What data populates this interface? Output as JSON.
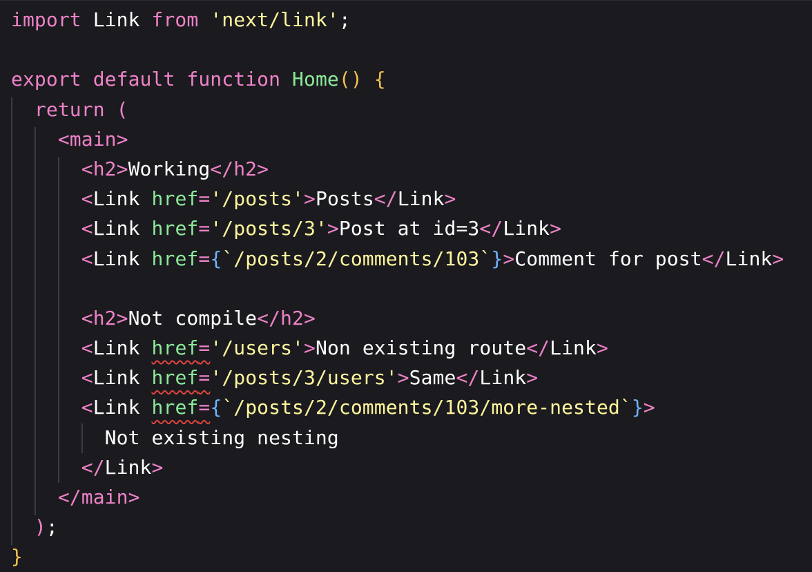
{
  "editor": {
    "lines": [
      {
        "tokens": [
          [
            "k",
            "import"
          ],
          [
            "pl",
            " Link "
          ],
          [
            "k",
            "from"
          ],
          [
            "pl",
            " "
          ],
          [
            "st",
            "'next/link'"
          ],
          [
            "pl",
            ";"
          ]
        ]
      },
      {
        "tokens": []
      },
      {
        "tokens": [
          [
            "k",
            "export"
          ],
          [
            "pl",
            " "
          ],
          [
            "k",
            "default"
          ],
          [
            "pl",
            " "
          ],
          [
            "k",
            "function"
          ],
          [
            "pl",
            " "
          ],
          [
            "fn",
            "Home"
          ],
          [
            "br",
            "()"
          ],
          [
            "pl",
            " "
          ],
          [
            "br",
            "{"
          ]
        ]
      },
      {
        "tokens": [
          [
            "pl",
            "  "
          ],
          [
            "k",
            "return"
          ],
          [
            "pl",
            " "
          ],
          [
            "op",
            "("
          ]
        ]
      },
      {
        "tokens": [
          [
            "pl",
            "    "
          ],
          [
            "tg",
            "<main>"
          ]
        ]
      },
      {
        "tokens": [
          [
            "pl",
            "      "
          ],
          [
            "tg",
            "<h2>"
          ],
          [
            "tw",
            "Working"
          ],
          [
            "tg",
            "</h2>"
          ]
        ]
      },
      {
        "tokens": [
          [
            "pl",
            "      "
          ],
          [
            "tg",
            "<"
          ],
          [
            "tw",
            "Link"
          ],
          [
            "pl",
            " "
          ],
          [
            "at",
            "href"
          ],
          [
            "op",
            "="
          ],
          [
            "st",
            "'/posts'"
          ],
          [
            "tg",
            ">"
          ],
          [
            "tw",
            "Posts"
          ],
          [
            "tg",
            "</"
          ],
          [
            "tw",
            "Link"
          ],
          [
            "tg",
            ">"
          ]
        ]
      },
      {
        "tokens": [
          [
            "pl",
            "      "
          ],
          [
            "tg",
            "<"
          ],
          [
            "tw",
            "Link"
          ],
          [
            "pl",
            " "
          ],
          [
            "at",
            "href"
          ],
          [
            "op",
            "="
          ],
          [
            "st",
            "'/posts/3'"
          ],
          [
            "tg",
            ">"
          ],
          [
            "tw",
            "Post at id=3"
          ],
          [
            "tg",
            "</"
          ],
          [
            "tw",
            "Link"
          ],
          [
            "tg",
            ">"
          ]
        ]
      },
      {
        "tokens": [
          [
            "pl",
            "      "
          ],
          [
            "tg",
            "<"
          ],
          [
            "tw",
            "Link"
          ],
          [
            "pl",
            " "
          ],
          [
            "at",
            "href"
          ],
          [
            "op",
            "="
          ],
          [
            "bb",
            "{"
          ],
          [
            "bt",
            "`/posts/2/comments/103`"
          ],
          [
            "bb",
            "}"
          ],
          [
            "tg",
            ">"
          ],
          [
            "tw",
            "Comment for post"
          ],
          [
            "tg",
            "</"
          ],
          [
            "tw",
            "Link"
          ],
          [
            "tg",
            ">"
          ]
        ]
      },
      {
        "tokens": []
      },
      {
        "tokens": [
          [
            "pl",
            "      "
          ],
          [
            "tg",
            "<h2>"
          ],
          [
            "tw",
            "Not compile"
          ],
          [
            "tg",
            "</h2>"
          ]
        ]
      },
      {
        "tokens": [
          [
            "pl",
            "      "
          ],
          [
            "tg",
            "<"
          ],
          [
            "tw",
            "Link"
          ],
          [
            "pl",
            " "
          ],
          [
            "at wavy",
            "href"
          ],
          [
            "op wavy",
            "="
          ],
          [
            "st",
            "'/users'"
          ],
          [
            "tg",
            ">"
          ],
          [
            "tw",
            "Non existing route"
          ],
          [
            "tg",
            "</"
          ],
          [
            "tw",
            "Link"
          ],
          [
            "tg",
            ">"
          ]
        ]
      },
      {
        "tokens": [
          [
            "pl",
            "      "
          ],
          [
            "tg",
            "<"
          ],
          [
            "tw",
            "Link"
          ],
          [
            "pl",
            " "
          ],
          [
            "at wavy",
            "href"
          ],
          [
            "op wavy",
            "="
          ],
          [
            "st",
            "'/posts/3/users'"
          ],
          [
            "tg",
            ">"
          ],
          [
            "tw",
            "Same"
          ],
          [
            "tg",
            "</"
          ],
          [
            "tw",
            "Link"
          ],
          [
            "tg",
            ">"
          ]
        ]
      },
      {
        "tokens": [
          [
            "pl",
            "      "
          ],
          [
            "tg",
            "<"
          ],
          [
            "tw",
            "Link"
          ],
          [
            "pl",
            " "
          ],
          [
            "at wavy",
            "href"
          ],
          [
            "op wavy",
            "="
          ],
          [
            "bb",
            "{"
          ],
          [
            "bt",
            "`/posts/2/comments/103/more-nested`"
          ],
          [
            "bb",
            "}"
          ],
          [
            "tg",
            ">"
          ]
        ]
      },
      {
        "tokens": [
          [
            "pl",
            "        "
          ],
          [
            "tw",
            "Not existing nesting"
          ]
        ]
      },
      {
        "tokens": [
          [
            "pl",
            "      "
          ],
          [
            "tg",
            "</"
          ],
          [
            "tw",
            "Link"
          ],
          [
            "tg",
            ">"
          ]
        ]
      },
      {
        "tokens": [
          [
            "pl",
            "    "
          ],
          [
            "tg",
            "</main>"
          ]
        ]
      },
      {
        "tokens": [
          [
            "pl",
            "  "
          ],
          [
            "op",
            ")"
          ],
          [
            "pl",
            ";"
          ]
        ]
      },
      {
        "tokens": [
          [
            "br",
            "}"
          ]
        ]
      }
    ]
  }
}
